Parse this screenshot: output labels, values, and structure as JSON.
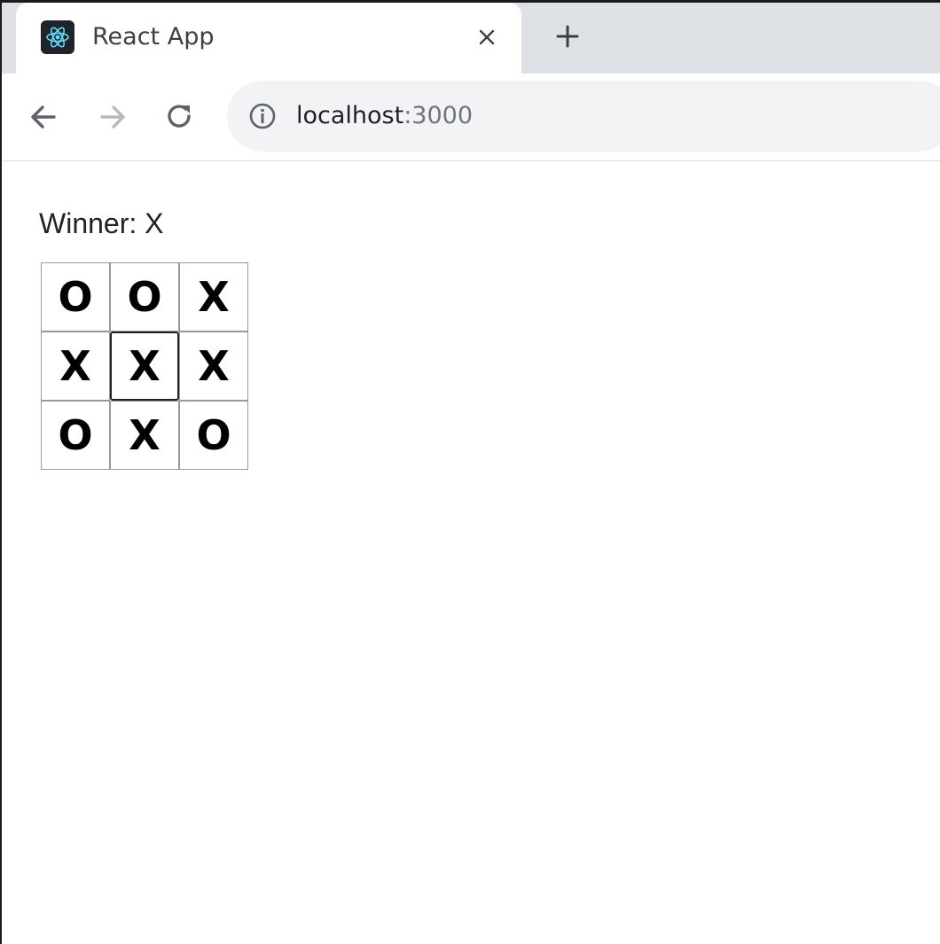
{
  "browser": {
    "tab": {
      "title": "React App",
      "favicon": "react-logo-icon",
      "close_icon": "close-icon"
    },
    "new_tab_icon": "plus-icon",
    "nav": {
      "back_icon": "arrow-left-icon",
      "forward_icon": "arrow-right-icon",
      "reload_icon": "reload-icon"
    },
    "address": {
      "info_icon": "info-icon",
      "host": "localhost",
      "port": ":3000"
    }
  },
  "game": {
    "status": "Winner: X",
    "board": [
      "O",
      "O",
      "X",
      "X",
      "X",
      "X",
      "O",
      "X",
      "O"
    ],
    "focused_square_index": 4
  },
  "colors": {
    "tabstrip": "#dee1e6",
    "omnibox": "#f1f3f4",
    "react_blue": "#61dafb"
  }
}
